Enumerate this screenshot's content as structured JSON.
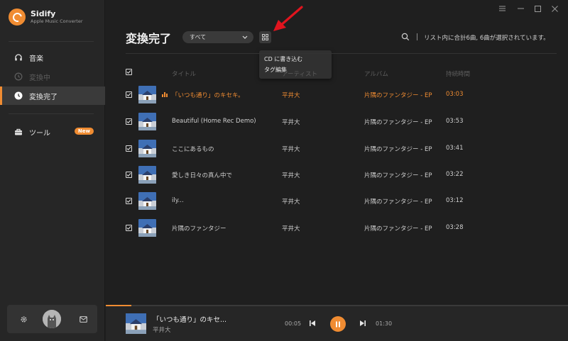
{
  "brand": {
    "name": "Sidify",
    "subtitle": "Apple Music Converter"
  },
  "sidebar": {
    "items": [
      {
        "label": "音楽",
        "icon": "headphones-icon",
        "state": "normal"
      },
      {
        "label": "変換中",
        "icon": "clock-icon",
        "state": "disabled"
      },
      {
        "label": "変換完了",
        "icon": "clock-icon",
        "state": "active"
      },
      {
        "label": "ツール",
        "icon": "toolbox-icon",
        "badge": "New"
      }
    ]
  },
  "bottom_tools": {
    "icons": [
      "settings-icon",
      "avatar",
      "mail-icon"
    ]
  },
  "window_controls": [
    "menu-icon",
    "minimize-icon",
    "maximize-icon",
    "close-icon"
  ],
  "header": {
    "title": "変換完了",
    "filter_value": "すべて",
    "summary": "リスト内に合計6曲, 6曲が選択されています。"
  },
  "context_menu": {
    "items": [
      "CD に書き込む",
      "タグ編集"
    ]
  },
  "table": {
    "columns": [
      "タイトル",
      "アーティスト",
      "アルバム",
      "持続時間"
    ],
    "rows": [
      {
        "title": "「いつも通り」のキセキ。",
        "artist": "平井大",
        "album": "片隅のファンタジー - EP",
        "duration": "03:03",
        "playing": true,
        "checked": true
      },
      {
        "title": "Beautiful (Home Rec Demo)",
        "artist": "平井大",
        "album": "片隅のファンタジー - EP",
        "duration": "03:53",
        "playing": false,
        "checked": true
      },
      {
        "title": "ここにあるもの",
        "artist": "平井大",
        "album": "片隅のファンタジー - EP",
        "duration": "03:41",
        "playing": false,
        "checked": true
      },
      {
        "title": "愛しき日々の真ん中で",
        "artist": "平井大",
        "album": "片隅のファンタジー - EP",
        "duration": "03:22",
        "playing": false,
        "checked": true
      },
      {
        "title": "ily...",
        "artist": "平井大",
        "album": "片隅のファンタジー - EP",
        "duration": "03:12",
        "playing": false,
        "checked": true
      },
      {
        "title": "片隅のファンタジー",
        "artist": "平井大",
        "album": "片隅のファンタジー - EP",
        "duration": "03:28",
        "playing": false,
        "checked": true
      }
    ]
  },
  "player": {
    "title": "「いつも通り」のキセ...",
    "artist": "平井大",
    "elapsed": "00:05",
    "total": "01:30",
    "progress": 0.055
  },
  "colors": {
    "accent": "#f08c32",
    "background": "#1f1f1f",
    "sidebar": "#262626",
    "annotation_arrow": "#e0141e"
  }
}
